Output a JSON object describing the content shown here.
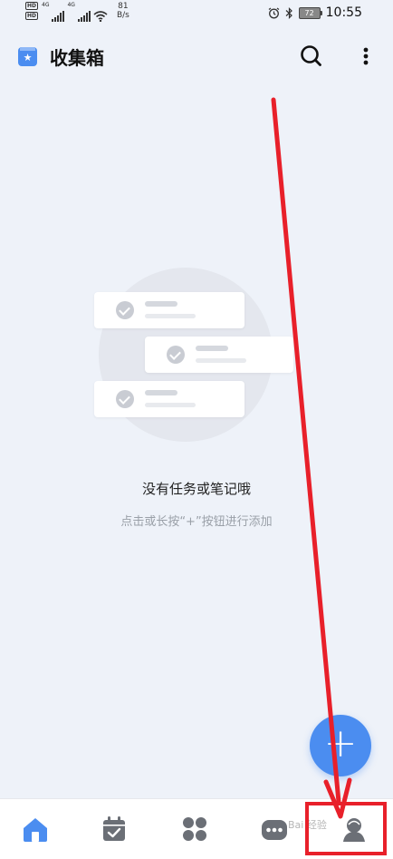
{
  "status_bar": {
    "hd1": "HD",
    "hd2": "HD",
    "net1": "4G",
    "net2": "4G",
    "speed_value": "81",
    "speed_unit": "B/s",
    "battery": "72",
    "time": "10:55"
  },
  "header": {
    "title": "收集箱",
    "inbox_icon_glyph": "★"
  },
  "empty_state": {
    "title": "没有任务或笔记哦",
    "hint": "点击或长按“+”按钮进行添加"
  },
  "fab": {
    "label": "+"
  },
  "watermark": {
    "text": "Bai 经验"
  },
  "bottom_nav": {
    "items": [
      {
        "icon": "home-icon"
      },
      {
        "icon": "calendar-icon"
      },
      {
        "icon": "apps-grid-icon"
      },
      {
        "icon": "more-dots-icon"
      },
      {
        "icon": "profile-icon"
      }
    ]
  },
  "colors": {
    "accent": "#4b8df0",
    "background": "#eef2f9",
    "annotation": "#e8202a"
  }
}
